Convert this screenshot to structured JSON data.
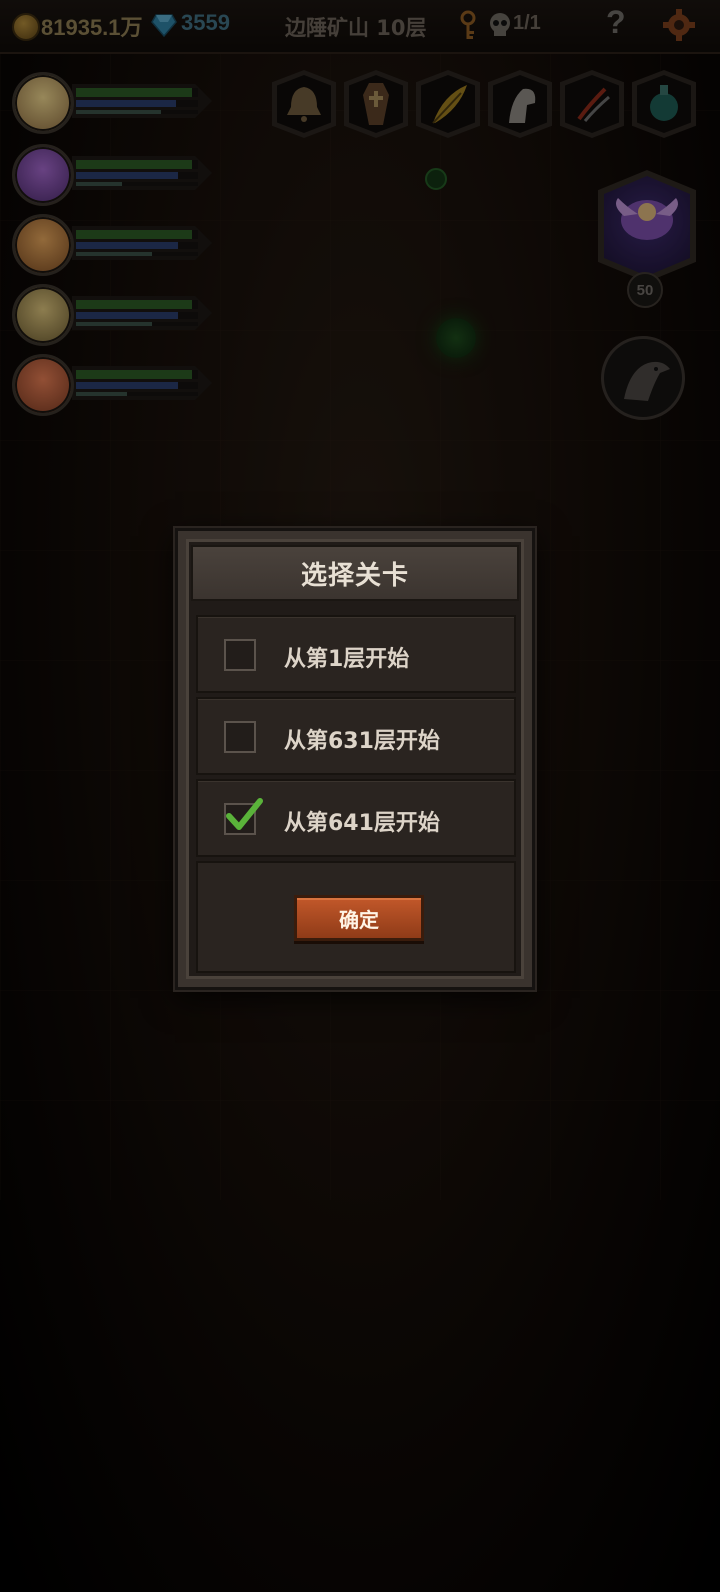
{
  "topbar": {
    "gold": "81935.1万",
    "gems": "3559",
    "location": "边陲矿山 10层",
    "kills": "1/1",
    "help": "?"
  },
  "party": [
    {
      "name": "hero-1",
      "hp": 0.95,
      "mp": 0.82,
      "xp": 0.7
    },
    {
      "name": "hero-2",
      "hp": 0.95,
      "mp": 0.84,
      "xp": 0.38
    },
    {
      "name": "hero-3",
      "hp": 0.95,
      "mp": 0.84,
      "xp": 0.62
    },
    {
      "name": "hero-4",
      "hp": 0.95,
      "mp": 0.84,
      "xp": 0.62
    },
    {
      "name": "hero-5",
      "hp": 0.95,
      "mp": 0.84,
      "xp": 0.42
    }
  ],
  "skills": [
    "bell-icon",
    "coffin-icon",
    "feather-icon",
    "horse-icon",
    "claw-icon",
    "potion-icon"
  ],
  "boss": {
    "level": "50"
  },
  "dialog": {
    "title": "选择关卡",
    "options": [
      {
        "label": "从第1层开始",
        "checked": false
      },
      {
        "label": "从第631层开始",
        "checked": false
      },
      {
        "label": "从第641层开始",
        "checked": true
      }
    ],
    "confirm": "确定"
  },
  "colors": {
    "accent_button": "#b24e22",
    "check": "#5ab33a",
    "hp": "#2c5a25",
    "mp": "#2a3c6a"
  }
}
